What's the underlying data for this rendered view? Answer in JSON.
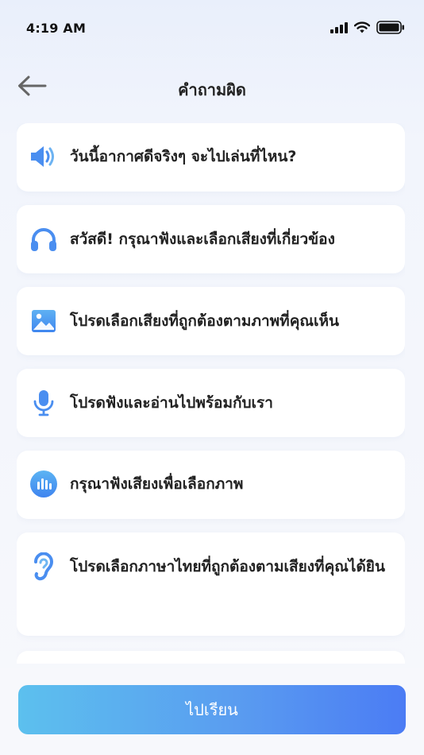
{
  "status_bar": {
    "time": "4:19 AM"
  },
  "header": {
    "title": "คำถามผิด"
  },
  "items": [
    {
      "icon": "speaker-icon",
      "text": "วันนี้อากาศดีจริงๆ จะไปเล่นที่ไหน?"
    },
    {
      "icon": "headphones-icon",
      "text": "สวัสดี! กรุณาฟังและเลือกเสียงที่เกี่ยวข้อง"
    },
    {
      "icon": "image-icon",
      "text": "โปรดเลือกเสียงที่ถูกต้องตามภาพที่คุณเห็น"
    },
    {
      "icon": "microphone-icon",
      "text": "โปรดฟังและอ่านไปพร้อมกับเรา"
    },
    {
      "icon": "audio-wave-icon",
      "text": "กรุณาฟังเสียงเพื่อเลือกภาพ"
    },
    {
      "icon": "ear-icon",
      "text": "โปรดเลือกภาษาไทยที่ถูกต้องตามเสียงที่คุณได้ยิน"
    }
  ],
  "footer": {
    "button_label": "ไปเรียน"
  },
  "colors": {
    "accent": "#4a8ef0",
    "accent_light": "#5cc0ee",
    "title": "#222222"
  }
}
